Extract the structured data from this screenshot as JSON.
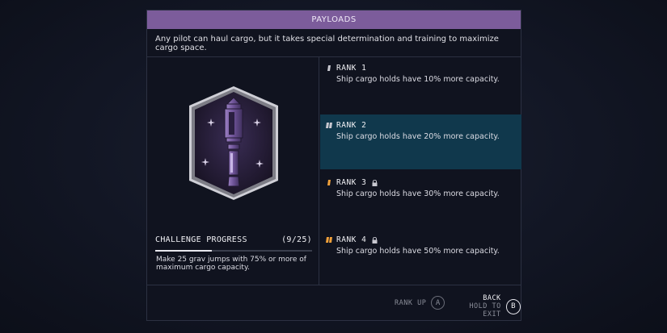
{
  "panel": {
    "title": "PAYLOADS",
    "description": "Any pilot can haul cargo, but it takes special determination and training to maximize cargo space."
  },
  "challenge": {
    "label": "CHALLENGE PROGRESS",
    "count": "(9/25)",
    "progress": 0.36,
    "description": "Make 25 grav jumps with 75% or more of maximum cargo capacity."
  },
  "ranks": [
    {
      "label": "RANK 1",
      "description": "Ship cargo holds have 10% more capacity.",
      "locked": false,
      "active": false,
      "icon_color": "#c8c8d0"
    },
    {
      "label": "RANK 2",
      "description": "Ship cargo holds have 20% more capacity.",
      "locked": false,
      "active": true,
      "icon_color": "#c8c8d0"
    },
    {
      "label": "RANK 3",
      "description": "Ship cargo holds have 30% more capacity.",
      "locked": true,
      "active": false,
      "icon_color": "#f2a13a"
    },
    {
      "label": "RANK 4",
      "description": "Ship cargo holds have 50% more capacity.",
      "locked": true,
      "active": false,
      "icon_color": "#f2a13a"
    }
  ],
  "footer": {
    "rank_up_label": "RANK UP",
    "rank_up_key": "A",
    "back_label": "BACK",
    "back_sub_label": "HOLD TO EXIT",
    "back_key": "B"
  },
  "colors": {
    "header": "#7c5c9b",
    "active_rank": "#10384c",
    "locked_icon": "#f2a13a"
  }
}
